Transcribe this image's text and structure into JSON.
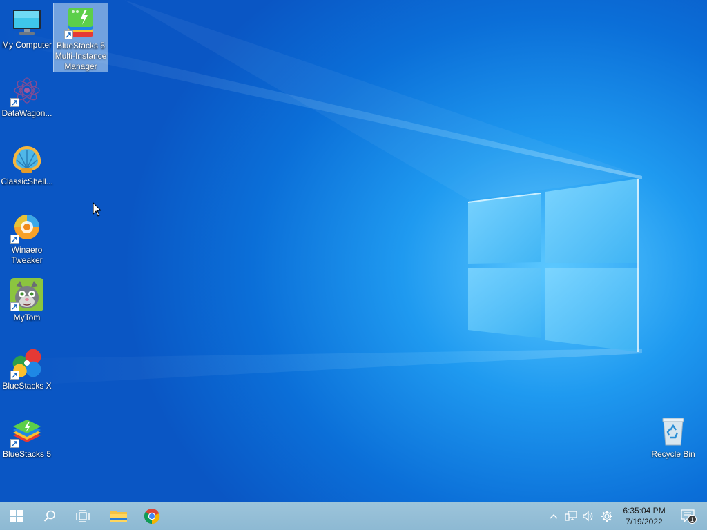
{
  "desktop": {
    "icons": [
      {
        "label": "My Computer",
        "icon": "monitor-icon",
        "shortcut": false,
        "selected": false
      },
      {
        "label": "BlueStacks 5 Multi-Instance Manager",
        "icon": "bluestacks-multi-instance-icon",
        "shortcut": true,
        "selected": true
      },
      {
        "label": "DataWagon...",
        "icon": "datawagon-icon",
        "shortcut": true,
        "selected": false
      },
      {
        "label": "ClassicShell...",
        "icon": "classic-shell-icon",
        "shortcut": false,
        "selected": false
      },
      {
        "label": "Winaero Tweaker",
        "icon": "winaero-tweaker-icon",
        "shortcut": true,
        "selected": false
      },
      {
        "label": "MyTom",
        "icon": "mytom-icon",
        "shortcut": true,
        "selected": false
      },
      {
        "label": "BlueStacks X",
        "icon": "bluestacks-x-icon",
        "shortcut": true,
        "selected": false
      },
      {
        "label": "BlueStacks 5",
        "icon": "bluestacks-5-icon",
        "shortcut": true,
        "selected": false
      },
      {
        "label": "Recycle Bin",
        "icon": "recycle-bin-icon",
        "shortcut": false,
        "selected": false
      }
    ]
  },
  "taskbar": {
    "buttons": [
      {
        "name": "start",
        "icon": "windows-logo-icon"
      },
      {
        "name": "search",
        "icon": "search-icon"
      },
      {
        "name": "task-view",
        "icon": "task-view-icon"
      },
      {
        "name": "file-explorer",
        "icon": "folder-icon"
      },
      {
        "name": "chrome",
        "icon": "chrome-icon"
      }
    ],
    "tray": {
      "icons": [
        "chevron-up-icon",
        "network-icon",
        "volume-icon",
        "settings-gear-icon"
      ],
      "time": "6:35:04 PM",
      "date": "7/19/2022",
      "notification_count": "1"
    }
  },
  "colors": {
    "taskbar": "#8db9d3",
    "accent": "#0b6fd8"
  }
}
